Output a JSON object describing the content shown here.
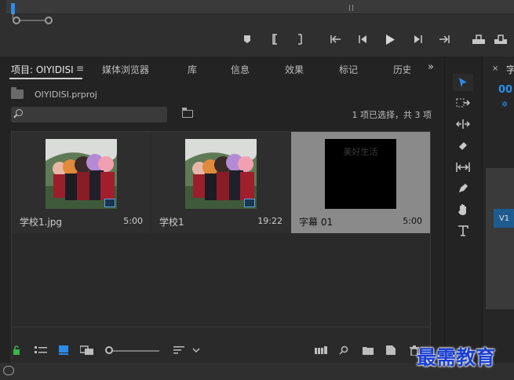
{
  "panel_tabs": [
    {
      "label": "项目: OIYIDISI"
    },
    {
      "label": "媒体浏览器"
    },
    {
      "label": "库"
    },
    {
      "label": "信息"
    },
    {
      "label": "效果"
    },
    {
      "label": "标记"
    },
    {
      "label": "历史"
    }
  ],
  "project": {
    "file_name": "OIYIDISI.prproj",
    "search_placeholder": "",
    "selection_status": "1 项已选择，共 3 项"
  },
  "items": [
    {
      "name": "学校1.jpg",
      "duration": "5:00",
      "kind": "still-image"
    },
    {
      "name": "学校1",
      "duration": "19:22",
      "kind": "sequence"
    },
    {
      "name": "字幕 01",
      "duration": "5:00",
      "kind": "title",
      "caption": "美好生活",
      "selected": true
    }
  ],
  "right_panel": {
    "title": "字",
    "timecode": "00",
    "track_label": "V1"
  },
  "watermark": "最需教育",
  "colors": {
    "accent": "#2d8ceb",
    "selected_card": "#8a8a8a",
    "lock_green": "#3bb54a",
    "watermark": "#1a3fd0"
  }
}
